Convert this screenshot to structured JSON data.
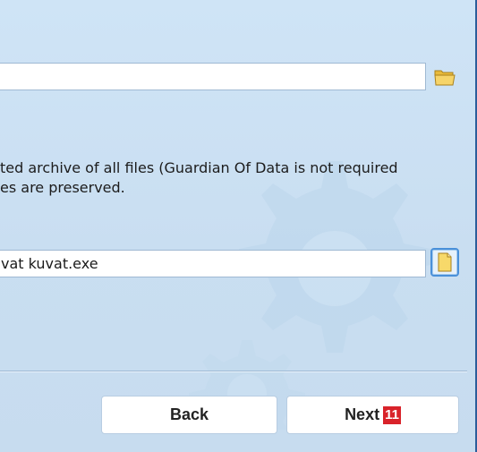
{
  "output_folder": {
    "value": "",
    "icon": "folder-open-icon"
  },
  "description": {
    "line1": "ted archive of all files (Guardian Of Data is not required",
    "line2": "es are preserved."
  },
  "archive_file": {
    "value": "vat kuvat.exe",
    "icon": "file-icon"
  },
  "buttons": {
    "back_label": "Back",
    "next_label": "Next",
    "next_badge": "11"
  },
  "colors": {
    "background": "#cfe3f4",
    "badge": "#d9232a",
    "folder_icon": "#f2c94c"
  }
}
